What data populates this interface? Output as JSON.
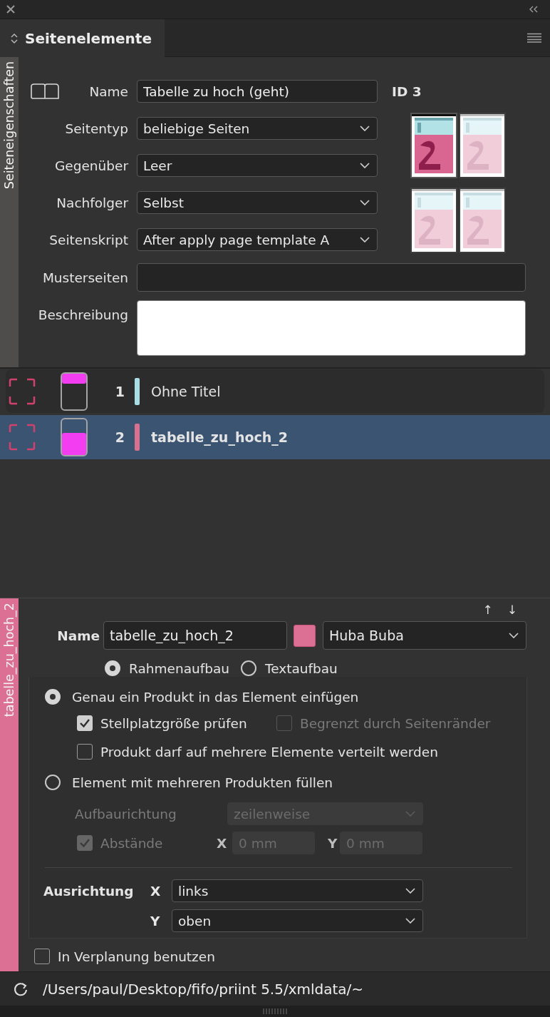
{
  "panel_tab": {
    "title": "Seitenelemente",
    "selected": true
  },
  "page_properties": {
    "side_tab": "Seiteneigenschaften",
    "name_label": "Name",
    "name": "Tabelle zu hoch (geht)",
    "id": "ID 3",
    "fields": [
      {
        "label": "Seitentyp",
        "value": "beliebige Seiten",
        "kind": "dropdown"
      },
      {
        "label": "Gegenüber",
        "value": "Leer",
        "kind": "dropdown"
      },
      {
        "label": "Nachfolger",
        "value": "Selbst",
        "kind": "dropdown"
      },
      {
        "label": "Seitenskript",
        "value": "After apply page template A",
        "kind": "dropdown"
      }
    ],
    "master_pages_label": "Musterseiten",
    "description_label": "Beschreibung",
    "thumbnails": [
      {
        "selected": true
      },
      {
        "selected": false
      },
      {
        "selected": false
      },
      {
        "selected": false
      }
    ]
  },
  "elements": [
    {
      "number": "1",
      "name": "Ohne Titel",
      "selected": false,
      "kind": "header",
      "color": "#a8dde3"
    },
    {
      "number": "2",
      "name": "tabelle_zu_hoch_2",
      "selected": true,
      "kind": "body",
      "color": "#d8708f"
    }
  ],
  "element_editor": {
    "side_tab": "tabelle_zu_hoch_2",
    "move_up": "↑",
    "move_down": "↓",
    "name_label": "Name",
    "name": "tabelle_zu_hoch_2",
    "color": "#dc7094",
    "group": "Huba Buba",
    "build_modes": [
      {
        "label": "Rahmenaufbau",
        "selected": true
      },
      {
        "label": "Textaufbau",
        "selected": false
      }
    ],
    "fill_modes": [
      {
        "label": "Genau ein Produkt in das Element einfügen",
        "selected": true
      },
      {
        "label": "Element mit mehreren Produkten füllen",
        "selected": false
      }
    ],
    "single_options": [
      {
        "checkboxes": [
          {
            "label": "Stellplatzgröße prüfen",
            "checked": true,
            "disabled": false
          },
          {
            "label": "Begrenzt durch Seitenränder",
            "checked": false,
            "disabled": true
          }
        ]
      },
      {
        "checkboxes": [
          {
            "label": "Produkt darf auf mehrere Elemente verteilt werden",
            "checked": false,
            "disabled": false
          }
        ]
      }
    ],
    "multi_options": {
      "disabled": true,
      "direction_label": "Aufbaurichtung",
      "direction": "zeilenweise",
      "spacing": {
        "label": "Abstände",
        "checked": true
      },
      "x_label": "X",
      "x_value": "0 mm",
      "y_label": "Y",
      "y_value": "0 mm"
    },
    "alignment": {
      "label": "Ausrichtung",
      "rows": [
        {
          "axis": "X",
          "value": "links"
        },
        {
          "axis": "Y",
          "value": "oben"
        }
      ]
    },
    "use_in_planning": {
      "label": "In Verplanung benutzen",
      "checked": false
    }
  },
  "status_bar": {
    "path": "/Users/paul/Desktop/fifo/priint 5.5/xmldata/~"
  }
}
